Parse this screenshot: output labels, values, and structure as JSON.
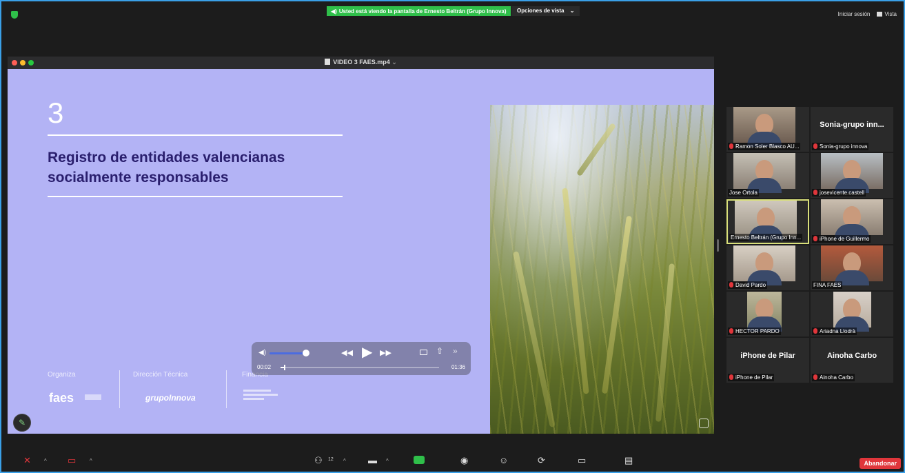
{
  "top_bar": {
    "share_banner": "Usted está viendo la pantalla de Ernesto Beltrán (Grupo Innova)",
    "view_options": "Opciones de vista",
    "view_options_chevron": "⌄",
    "sign_in": "Iniciar sesión",
    "view_label": "Vista",
    "security_color": "#2fbf4a"
  },
  "shared_window": {
    "title": "VIDEO 3 FAES.mp4",
    "title_chevron": "⌄",
    "slide": {
      "number": "3",
      "heading": "Registro de entidades valencianas socialmente responsables",
      "footer_organiza": "Organiza",
      "footer_direccion": "Dirección Técnica",
      "footer_financia": "Financia",
      "logo_faes": "faes",
      "logo_innova": "grupoInnova",
      "background_color": "#b3b3f5",
      "heading_color": "#2a1f6e"
    },
    "player": {
      "volume_icon": "◀)",
      "rewind_icon": "◀◀",
      "play_icon": "▶",
      "forward_icon": "▶▶",
      "share_icon": "⇧",
      "more_icon": "»",
      "time_elapsed": "00:02",
      "time_total": "01:36",
      "progress_fraction": 0.02,
      "volume_fraction": 0.9
    }
  },
  "participants": [
    {
      "name": "Ramon Soler Blasco AU...",
      "muted": true,
      "video": true
    },
    {
      "name": "Sonia-grupo innova",
      "display": "Sonia-grupo inn...",
      "muted": true,
      "video": false
    },
    {
      "name": "Jose Ortola",
      "muted": false,
      "video": true
    },
    {
      "name": "josevicente.castell",
      "muted": true,
      "video": true
    },
    {
      "name": "Ernesto Beltrán (Grupo Inn...",
      "muted": false,
      "video": true,
      "active_speaker": true
    },
    {
      "name": "iPhone de Guillermo",
      "muted": true,
      "video": true
    },
    {
      "name": "David Pardo",
      "muted": true,
      "video": true
    },
    {
      "name": "FINA FAES",
      "muted": false,
      "video": true
    },
    {
      "name": "HECTOR PARDO",
      "muted": true,
      "video": true
    },
    {
      "name": "Ariadna Llodrà",
      "muted": true,
      "video": true
    },
    {
      "name": "iPhone de Pilar",
      "display": "iPhone de Pilar",
      "muted": true,
      "video": false
    },
    {
      "name": "Ainoha Carbo",
      "display": "Ainoha Carbo",
      "muted": true,
      "video": false
    }
  ],
  "toolbar": {
    "mic_icon": "🎤",
    "video_icon": "📷",
    "caret": "^",
    "participants_icon": "👥",
    "participants_count": "12",
    "chat_icon": "💬",
    "share_icon": "↑",
    "record_icon": "◉",
    "reactions_icon": "☺",
    "apps_icon": "⟳",
    "whiteboard_icon": "▭",
    "notes_icon": "▤",
    "leave_label": "Abandonar",
    "leave_color": "#e0363b"
  },
  "annotate_icon": "✎"
}
